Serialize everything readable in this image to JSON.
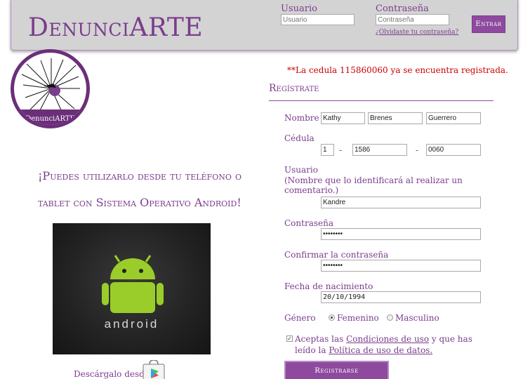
{
  "header": {
    "brand": "DenunciARTE",
    "user_label": "Usuario",
    "user_placeholder": "Usuario",
    "pass_label": "Contraseña",
    "pass_placeholder": "Contraseña",
    "forgot_link": "¿Olvidaste tu contraseña?",
    "login_button": "Entrar"
  },
  "logo": {
    "caption": "DenunciARTE"
  },
  "promo": {
    "text": "¡Puedes utilizarlo desde tu teléfono o tablet con Sistema Operativo Android!",
    "android_word": "android",
    "download_text": "Descárgalo desde"
  },
  "form": {
    "error": "**La cedula 115860060 ya se encuentra registrada.",
    "title": "Regístrate",
    "nombre_label": "Nombre",
    "nombre_values": [
      "Kathy",
      "Brenes",
      "Guerrero"
    ],
    "cedula_label": "Cédula",
    "cedula_values": [
      "1",
      "1586",
      "0060"
    ],
    "cedula_sep": "-",
    "usuario_label": "Usuario",
    "usuario_hint": "(Nombre que lo identificará al realizar un comentario.)",
    "usuario_value": "Kandre",
    "password_label": "Contraseña",
    "password_value": "••••••••",
    "confirm_label": "Confirmar la contraseña",
    "confirm_value": "••••••••",
    "birth_label": "Fecha de nacimiento",
    "birth_value": "20/10/1994",
    "gender_label": "Género",
    "gender_options": [
      "Femenino",
      "Masculino"
    ],
    "gender_selected": "Femenino",
    "terms_prefix": "Aceptas las",
    "terms_link1": "Condiciones de uso",
    "terms_mid": "y que has leído la",
    "terms_link2": "Política de uso de datos.",
    "terms_checked": true,
    "submit": "Registrarse"
  },
  "colors": {
    "accent": "#8e4a9e",
    "brand": "#7a3d8c",
    "error": "#cc0000",
    "header_bg": "#d3d3d3"
  }
}
